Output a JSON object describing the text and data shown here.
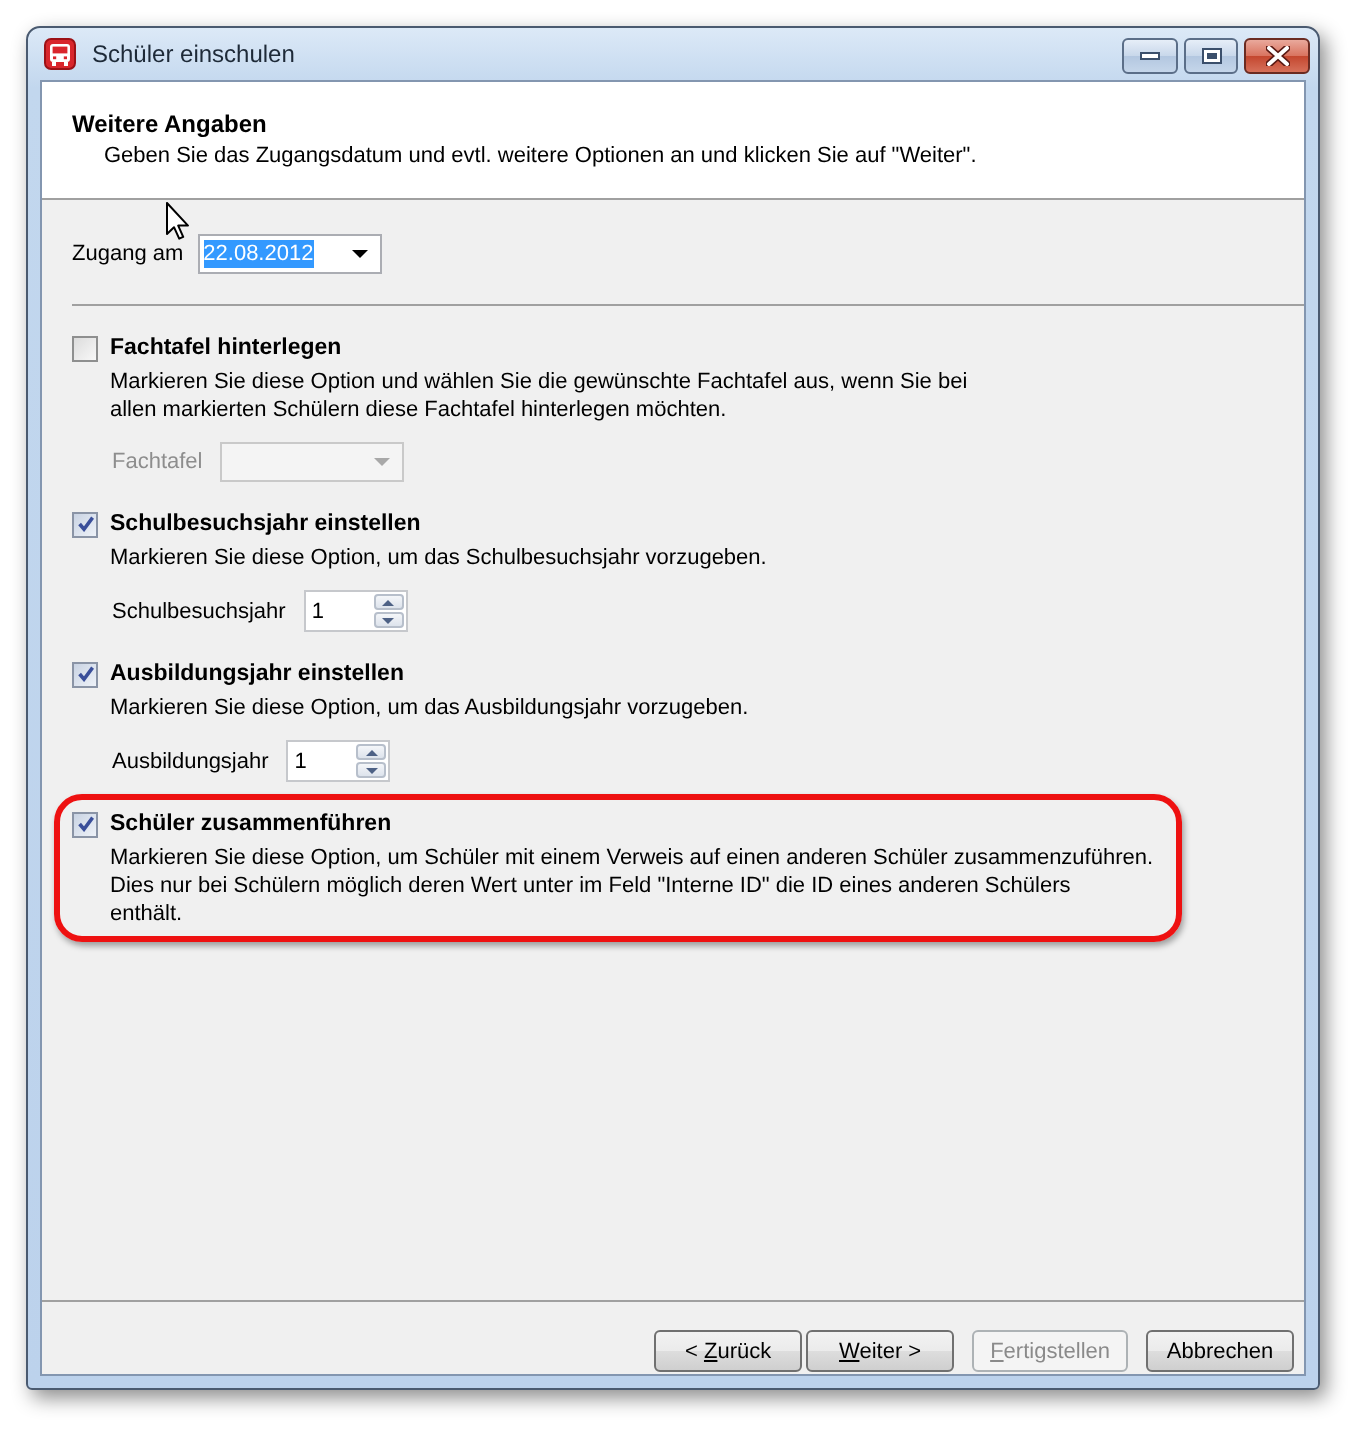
{
  "window": {
    "title": "Schüler einschulen"
  },
  "header": {
    "title": "Weitere Angaben",
    "subtitle": "Geben Sie das Zugangsdatum und evtl. weitere Optionen an und klicken Sie auf \"Weiter\"."
  },
  "entry_date": {
    "label": "Zugang am",
    "value": "22.08.2012",
    "selected": true
  },
  "options": [
    {
      "title": "Fachtafel hinterlegen",
      "checked": false,
      "highlighted": false,
      "description": "Markieren Sie diese Option und wählen Sie die gewünschte Fachtafel aus, wenn Sie bei\nallen markierten Schülern diese Fachtafel hinterlegen möchten.",
      "control": {
        "kind": "dropdown",
        "label": "Fachtafel",
        "disabled": true
      }
    },
    {
      "title": "Schulbesuchsjahr einstellen",
      "checked": true,
      "highlighted": false,
      "description": "Markieren Sie diese Option, um das Schulbesuchsjahr vorzugeben.",
      "control": {
        "kind": "spinner",
        "label": "Schulbesuchsjahr",
        "value": "1",
        "disabled": false
      }
    },
    {
      "title": "Ausbildungsjahr einstellen",
      "checked": true,
      "highlighted": false,
      "description": "Markieren Sie diese Option, um das Ausbildungsjahr vorzugeben.",
      "control": {
        "kind": "spinner",
        "label": "Ausbildungsjahr",
        "value": "1",
        "disabled": false
      }
    },
    {
      "title": "Schüler zusammenführen",
      "checked": true,
      "highlighted": true,
      "description": "Markieren Sie diese Option, um Schüler mit einem Verweis auf einen anderen Schüler zusammenzuführen.\nDies nur bei Schülern möglich deren Wert unter im Feld \"Interne ID\" die ID eines anderen Schülers\nenthält."
    }
  ],
  "buttons": [
    {
      "prefix": "< ",
      "mnemonic": "Z",
      "rest": "urück",
      "disabled": false
    },
    {
      "mnemonic": "W",
      "rest": "eiter >",
      "disabled": false
    },
    {
      "mnemonic": "F",
      "rest": "ertigstellen",
      "disabled": true
    },
    {
      "rest": "Abbrechen",
      "disabled": false
    }
  ]
}
